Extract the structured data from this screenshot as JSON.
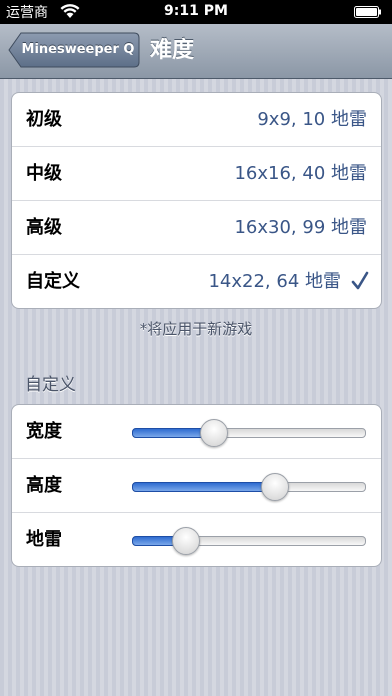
{
  "status_bar": {
    "carrier": "运营商",
    "time": "9:11 PM"
  },
  "nav": {
    "back_label": "Minesweeper Q",
    "title": "难度"
  },
  "difficulties": [
    {
      "label": "初级",
      "value": "9x9, 10 地雷",
      "checked": false
    },
    {
      "label": "中级",
      "value": "16x16, 40 地雷",
      "checked": false
    },
    {
      "label": "高级",
      "value": "16x30, 99 地雷",
      "checked": false
    },
    {
      "label": "自定义",
      "value": "14x22, 64 地雷",
      "checked": true
    }
  ],
  "note": "*将应用于新游戏",
  "custom_section": {
    "header": "自定义",
    "sliders": [
      {
        "label": "宽度",
        "fraction": 0.35
      },
      {
        "label": "高度",
        "fraction": 0.61
      },
      {
        "label": "地雷",
        "fraction": 0.23
      }
    ]
  },
  "colors": {
    "accent": "#3a5687",
    "slider_fill": "#2f6cd0"
  }
}
